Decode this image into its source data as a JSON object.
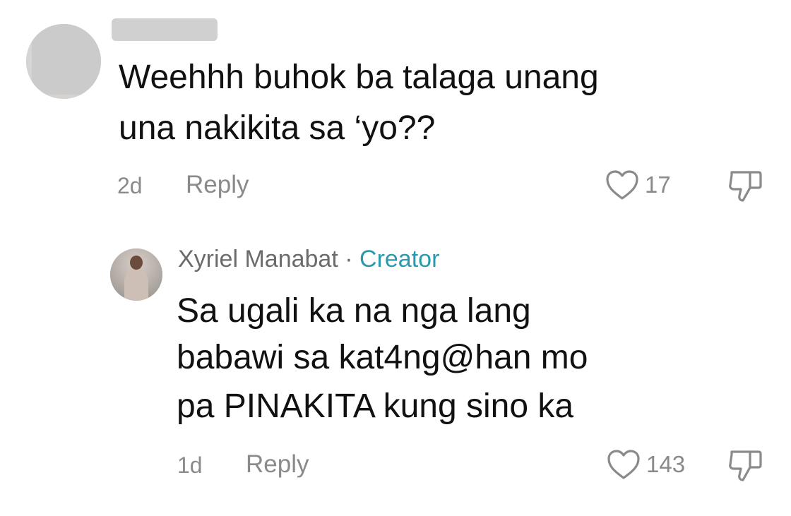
{
  "comments": [
    {
      "author": "",
      "text_lines": [
        "Weehhh buhok ba talaga unang",
        "una nakikita sa ‘yo??"
      ],
      "age": "2d",
      "reply_label": "Reply",
      "likes": "17"
    },
    {
      "author": "Xyriel Manabat",
      "author_separator": "·",
      "badge": "Creator",
      "text_lines": [
        "Sa ugali ka na nga lang",
        "babawi sa kat4ng@han mo",
        "pa PINAKITA kung sino ka"
      ],
      "age": "1d",
      "reply_label": "Reply",
      "likes": "143"
    }
  ],
  "colors": {
    "text": "#111111",
    "meta": "#8a8a8a",
    "creator_badge": "#2b98ad"
  },
  "icons": {
    "like": "heart-outline-icon",
    "dislike": "thumbs-down-outline-icon"
  }
}
